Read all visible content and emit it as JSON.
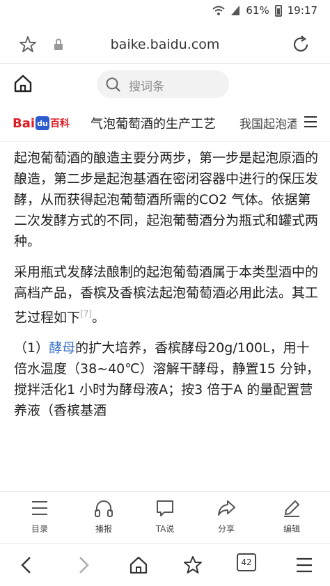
{
  "status_bar": {
    "battery": "61%",
    "time": "19:17"
  },
  "browser": {
    "domain": "baike.baidu.com"
  },
  "search": {
    "placeholder": "搜词条"
  },
  "tabs": {
    "logo_bai": "Bai",
    "logo_du": "du",
    "logo_baike": "百科",
    "active_tab": "气泡葡萄酒的生产工艺",
    "next_tab": "我国起泡酒"
  },
  "article": {
    "p1": "起泡葡萄酒的酿造主要分两步，第一步是起泡原酒的酿造，第二步是起泡基酒在密闭容器中进行的保压发酵，从而获得起泡葡萄酒所需的CO2 气体。依据第二次发酵方式的不同，起泡葡萄酒分为瓶式和罐式两种。",
    "p2": "采用瓶式发酵法酿制的起泡葡萄酒属于本类型酒中的高档产品，香槟及香槟法起泡葡萄酒必用此法。其工艺过程如下",
    "p2_ref": "[7]",
    "p2_end": "。",
    "p3_prefix": "（1）",
    "p3_link": "酵母",
    "p3_text": "的扩大培养，香槟酵母20g/100L，用十倍水温度（38~40℃）溶解干酵母，静置15 分钟，搅拌活化1 小时为酵母液A；按3 倍于A 的量配置营养液（香槟基酒"
  },
  "toolbar": {
    "contents": "目录",
    "play": "播报",
    "ta_says": "TA说",
    "share": "分享",
    "edit": "编辑"
  },
  "navbar": {
    "tab_count": "42"
  }
}
